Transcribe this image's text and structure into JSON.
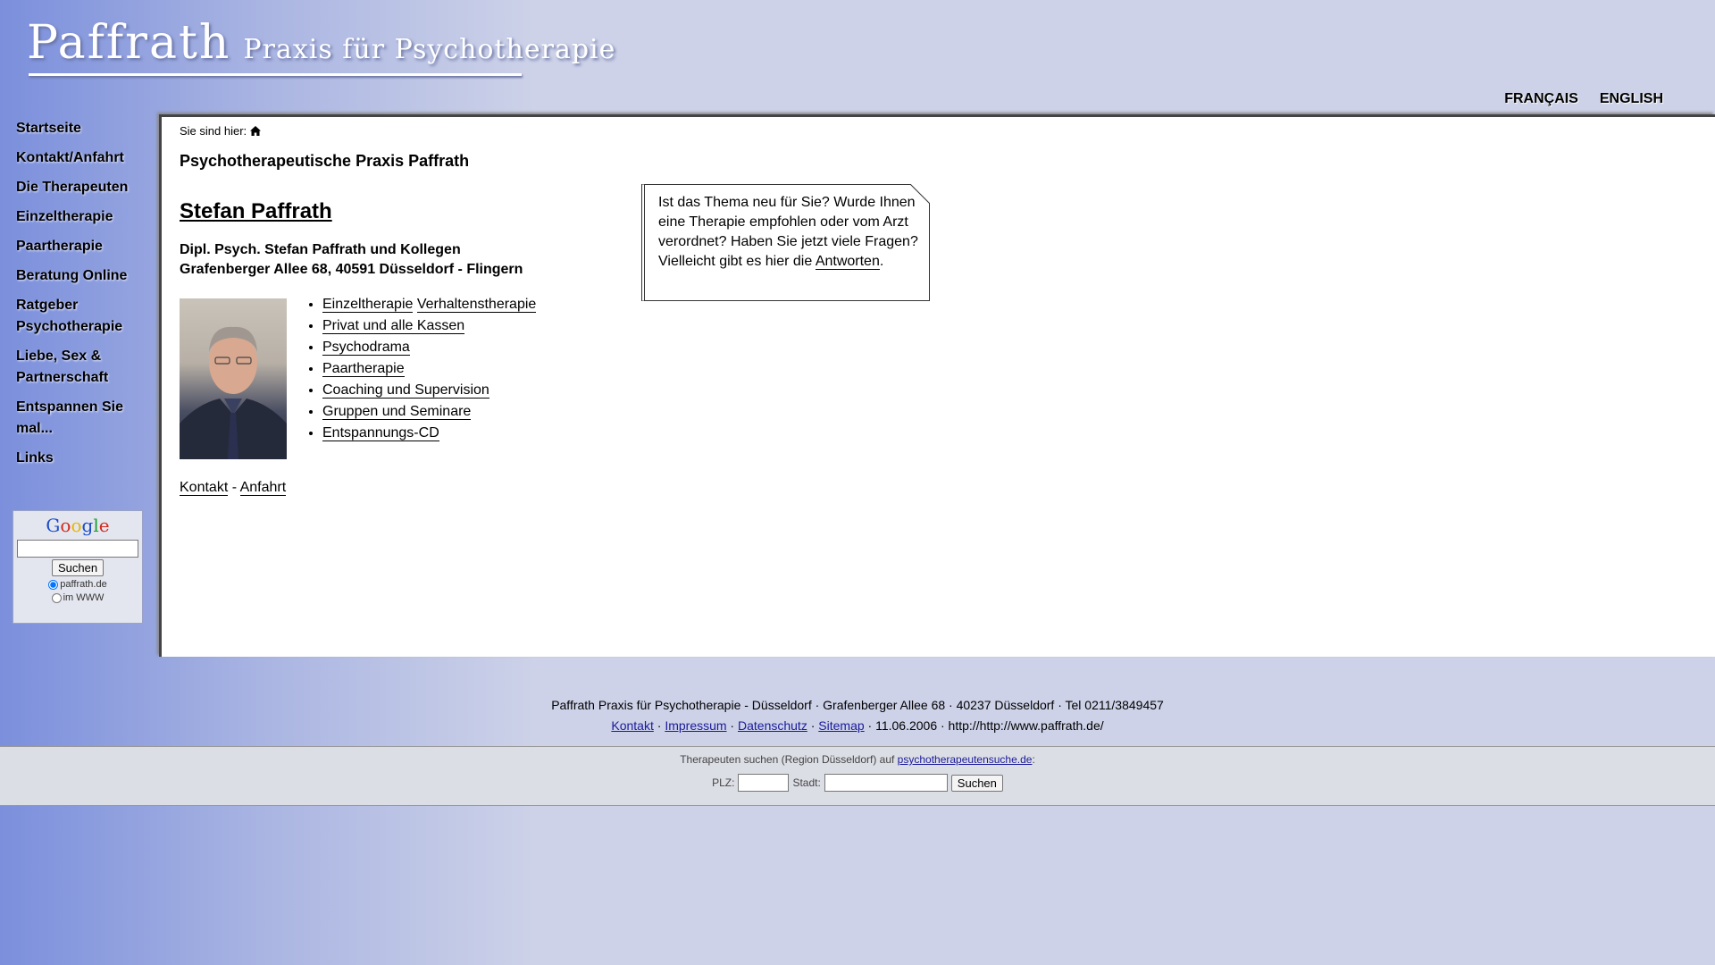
{
  "header": {
    "logo_name": "Paffrath",
    "logo_tagline": "Praxis für Psychotherapie",
    "languages": [
      "FRANÇAIS",
      "ENGLISH"
    ]
  },
  "nav": {
    "items": [
      "Startseite",
      "Kontakt/Anfahrt",
      "Die Therapeuten",
      "Einzeltherapie",
      "Paartherapie",
      "Beratung Online",
      "Ratgeber Psychotherapie",
      "Liebe, Sex & Partnerschaft",
      "Entspannen Sie mal...",
      "Links"
    ]
  },
  "google": {
    "logo": [
      "G",
      "o",
      "o",
      "g",
      "l",
      "e"
    ],
    "search_button": "Suchen",
    "radio_site": "paffrath.de",
    "radio_www": "im WWW"
  },
  "content": {
    "breadcrumb_label": "Sie sind hier:",
    "title": "Psychotherapeutische Praxis Paffrath",
    "name": "Stefan Paffrath",
    "sub1": "Dipl. Psych. Stefan Paffrath und Kollegen",
    "sub2": "Grafenberger Allee 68, 40591 Düsseldorf - Flingern",
    "links": [
      [
        "Einzeltherapie",
        "Verhaltenstherapie"
      ],
      [
        "Privat und alle Kassen"
      ],
      [
        "Psychodrama"
      ],
      [
        "Paartherapie"
      ],
      [
        "Coaching und Supervision"
      ],
      [
        "Gruppen und Seminare"
      ],
      [
        "Entspannungs-CD"
      ]
    ],
    "kontakt": "Kontakt",
    "kontakt_sep": " - ",
    "anfahrt": "Anfahrt",
    "note_text": "Ist das Thema neu für Sie? Wurde Ihnen eine Therapie empfohlen oder vom Arzt verordnet? Haben Sie jetzt viele Fragen? Vielleicht gibt es hier die",
    "note_link": "Antworten",
    "note_end": "."
  },
  "footer": {
    "address": "Paffrath Praxis für Psychotherapie - Düsseldorf · Grafenberger Allee 68 · 40237 Düsseldorf · Tel 0211/3849457",
    "links": [
      "Kontakt",
      "Impressum",
      "Datenschutz",
      "Sitemap"
    ],
    "date_url": " · 11.06.2006 · http://http://www.paffrath.de/",
    "search_text": "Therapeuten suchen (Region Düsseldorf) auf",
    "search_link": "psychotherapeutensuche.de",
    "search_colon": ":",
    "plz_label": "PLZ:",
    "stadt_label": "Stadt:",
    "search_button": "Suchen"
  }
}
